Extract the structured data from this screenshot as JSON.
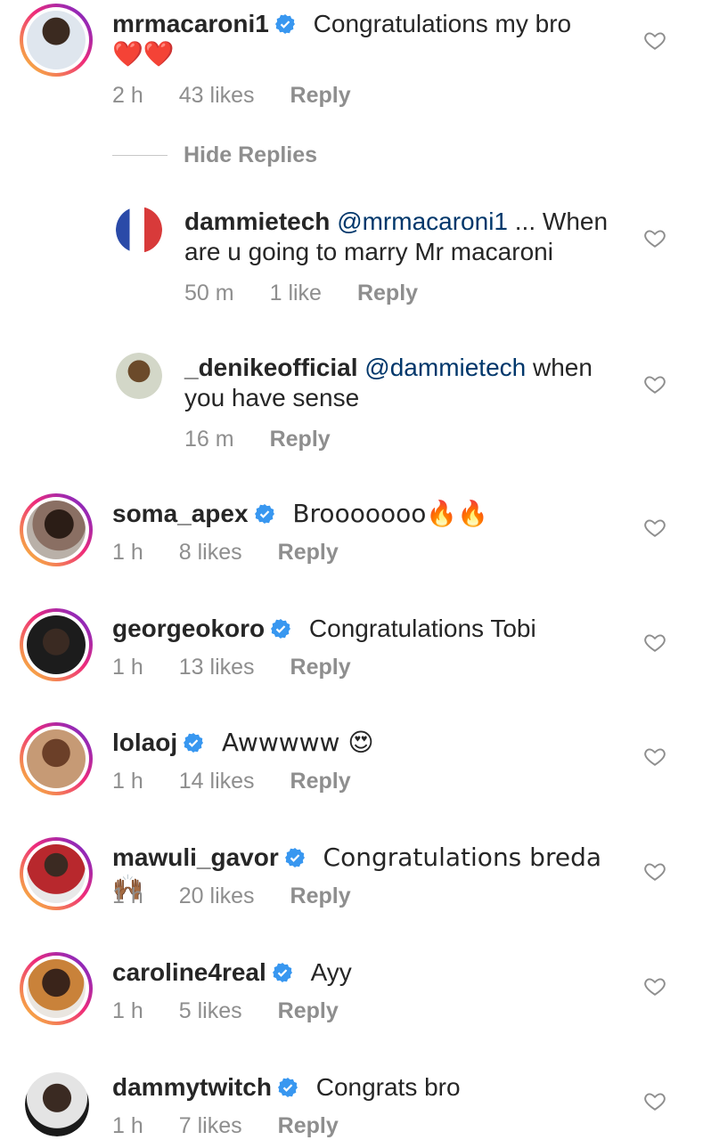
{
  "comments": [
    {
      "username": "mrmacaroni1",
      "verified": true,
      "text": "Congratulations my bro",
      "text2": "❤️❤️",
      "time": "2 h",
      "likes": "43 likes",
      "reply": "Reply"
    },
    {
      "username": "soma_apex",
      "verified": true,
      "text": "Brooooooo🔥🔥",
      "time": "1 h",
      "likes": "8 likes",
      "reply": "Reply"
    },
    {
      "username": "georgeokoro",
      "verified": true,
      "text": "Congratulations Tobi",
      "time": "1 h",
      "likes": "13 likes",
      "reply": "Reply"
    },
    {
      "username": "lolaoj",
      "verified": true,
      "text": "Awwwww 😍",
      "time": "1 h",
      "likes": "14 likes",
      "reply": "Reply"
    },
    {
      "username": "mawuli_gavor",
      "verified": true,
      "text": "Congratulations breda 🙌🏾",
      "time": "1 h",
      "likes": "20 likes",
      "reply": "Reply"
    },
    {
      "username": "caroline4real",
      "verified": true,
      "text": "Ayy",
      "time": "1 h",
      "likes": "5 likes",
      "reply": "Reply"
    },
    {
      "username": "dammytwitch",
      "verified": true,
      "text": "Congrats bro",
      "time": "1 h",
      "likes": "7 likes",
      "reply": "Reply"
    }
  ],
  "hide_replies": "Hide Replies",
  "replies": [
    {
      "username": "dammietech",
      "mention": "@mrmacaroni1",
      "text": " ... When are u going to marry Mr macaroni",
      "time": "50 m",
      "likes": "1 like",
      "reply": "Reply"
    },
    {
      "username": "_denikeofficial",
      "mention": "@dammietech",
      "text": " when you have sense",
      "time": "16 m",
      "likes": "",
      "reply": "Reply"
    }
  ],
  "icons": {
    "like": "heart-outline-icon",
    "verified": "verified-badge-icon"
  },
  "colors": {
    "verified": "#3897f0",
    "mention": "#00376b",
    "meta": "#8e8e8e"
  }
}
